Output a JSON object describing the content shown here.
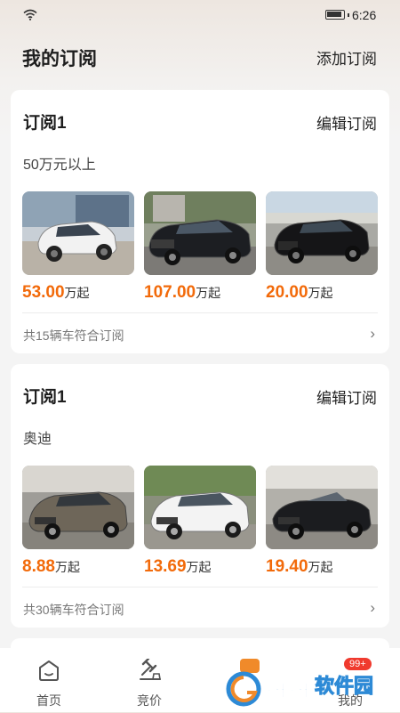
{
  "status": {
    "time": "6:26"
  },
  "header": {
    "title": "我的订阅",
    "add_label": "添加订阅"
  },
  "subscriptions": [
    {
      "title": "订阅1",
      "edit_label": "编辑订阅",
      "filter": "50万元以上",
      "cars": [
        {
          "price": "53.00",
          "unit": "万起",
          "image": "white-suv"
        },
        {
          "price": "107.00",
          "unit": "万起",
          "image": "black-sedan"
        },
        {
          "price": "20.00",
          "unit": "万起",
          "image": "black-sedan"
        }
      ],
      "match_text": "共15辆车符合订阅"
    },
    {
      "title": "订阅1",
      "edit_label": "编辑订阅",
      "filter": "奥迪",
      "cars": [
        {
          "price": "8.88",
          "unit": "万起",
          "image": "gray-sedan"
        },
        {
          "price": "13.69",
          "unit": "万起",
          "image": "white-sedan"
        },
        {
          "price": "19.40",
          "unit": "万起",
          "image": "black-convertible"
        }
      ],
      "match_text": "共30辆车符合订阅"
    }
  ],
  "tabbar": {
    "home": "首页",
    "auction": "竞价",
    "mine": "我的",
    "badge": "99+"
  },
  "watermark": "西西软件园",
  "colors": {
    "price": "#f26a0a",
    "badge": "#f03a2e"
  }
}
